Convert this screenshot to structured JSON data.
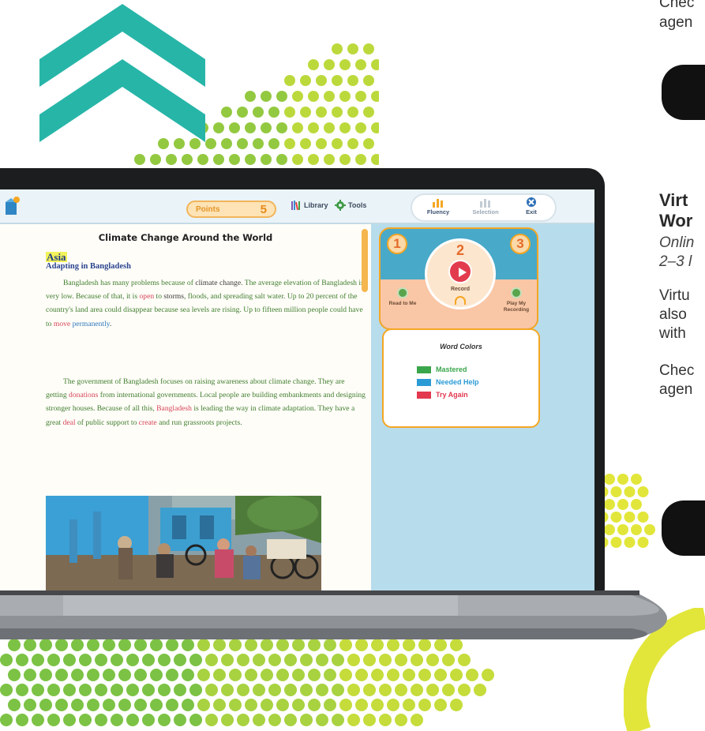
{
  "app": {
    "points_label": "Points",
    "points_value": "5",
    "library_label": "Library",
    "tools_label": "Tools",
    "fluency_label": "Fluency",
    "selection_label": "Selection",
    "exit_label": "Exit"
  },
  "reader": {
    "title": "Climate Change Around the World",
    "section": "Asia",
    "subsection": "Adapting in Bangladesh",
    "para1": [
      {
        "t": "Bangladesh has many problems because of ",
        "c": "g"
      },
      {
        "t": "climate change",
        "c": ""
      },
      {
        "t": ". The ",
        "c": "g"
      },
      {
        "t": "average elevation of Bangladesh is very low. Because of that, it is ",
        "c": "g"
      },
      {
        "t": "open",
        "c": "r"
      },
      {
        "t": " to ",
        "c": "g"
      },
      {
        "t": "storms",
        "c": ""
      },
      {
        "t": ", floods, and spreading salt water. Up to 20 percent of the country's land area could disappear because sea levels are rising. Up to fifteen million people could have to ",
        "c": "g"
      },
      {
        "t": "move",
        "c": "r"
      },
      {
        "t": " ",
        "c": ""
      },
      {
        "t": "permanently",
        "c": "b"
      },
      {
        "t": ".",
        "c": ""
      }
    ],
    "para2": [
      {
        "t": "The government of Bangladesh focuses on raising awareness about climate change. They are getting ",
        "c": "g"
      },
      {
        "t": "donations",
        "c": "r"
      },
      {
        "t": " from international governments. Local people are building embankments and designing stronger houses. Because of all this, ",
        "c": "g"
      },
      {
        "t": "Bangladesh",
        "c": "r"
      },
      {
        "t": " is leading the way in climate adaptation. They have a great ",
        "c": "g"
      },
      {
        "t": "deal",
        "c": "r"
      },
      {
        "t": " of public support to ",
        "c": "g"
      },
      {
        "t": "create",
        "c": "r"
      },
      {
        "t": " and run grassroots projects.",
        "c": "g"
      }
    ]
  },
  "recorder": {
    "step1": "1",
    "step2": "2",
    "step3": "3",
    "record_label": "Record",
    "read_to_me": "Read to Me",
    "play_recording": "Play My Recording"
  },
  "word_colors": {
    "title": "Word Colors",
    "items": [
      {
        "label": "Mastered",
        "color": "#3aa64b"
      },
      {
        "label": "Needed Help",
        "color": "#2b9bd6"
      },
      {
        "label": "Try Again",
        "color": "#e2394f"
      }
    ]
  },
  "colors": {
    "teal": "#27b5a8",
    "dot_green": "#93c940",
    "dot_yellow": "#e2e63a",
    "accent_orange": "#f5a623"
  },
  "sidebar_text": {
    "line_top1": "Chec",
    "line_top2": "agen",
    "heading1": "Virt",
    "heading2": "Wor",
    "sub1": "Onlin",
    "sub2": "2–3 l",
    "body1": "Virtu",
    "body2": "also",
    "body3": "with",
    "check2a": "Chec",
    "check2b": "agen"
  }
}
